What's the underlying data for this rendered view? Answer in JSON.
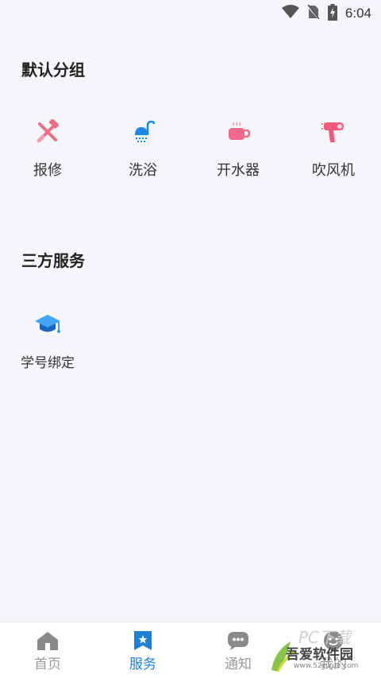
{
  "status_bar": {
    "time": "6:04"
  },
  "sections": [
    {
      "title": "默认分组",
      "items": [
        {
          "label": "报修",
          "icon": "repair-tools-icon",
          "color": "#ef6b86"
        },
        {
          "label": "洗浴",
          "icon": "shower-icon",
          "color": "#1e88e5"
        },
        {
          "label": "开水器",
          "icon": "hot-cup-icon",
          "color": "#f06b8b"
        },
        {
          "label": "吹风机",
          "icon": "hair-dryer-icon",
          "color": "#ef5a7e"
        }
      ]
    },
    {
      "title": "三方服务",
      "items": [
        {
          "label": "学号绑定",
          "icon": "graduation-cap-icon",
          "color": "#1e88e5"
        }
      ]
    }
  ],
  "tabbar": {
    "tabs": [
      {
        "label": "首页",
        "icon": "home-icon",
        "active": false
      },
      {
        "label": "服务",
        "icon": "service-bookmark-icon",
        "active": true
      },
      {
        "label": "通知",
        "icon": "chat-bubble-icon",
        "active": false
      },
      {
        "label": "我的",
        "icon": "profile-icon",
        "active": false
      }
    ],
    "active_color": "#1f7fd3",
    "inactive_color": "#9a9a9a"
  },
  "watermark": {
    "text": "吾爱软件园",
    "url": "www.52zixue.com",
    "art": "PC下载"
  }
}
